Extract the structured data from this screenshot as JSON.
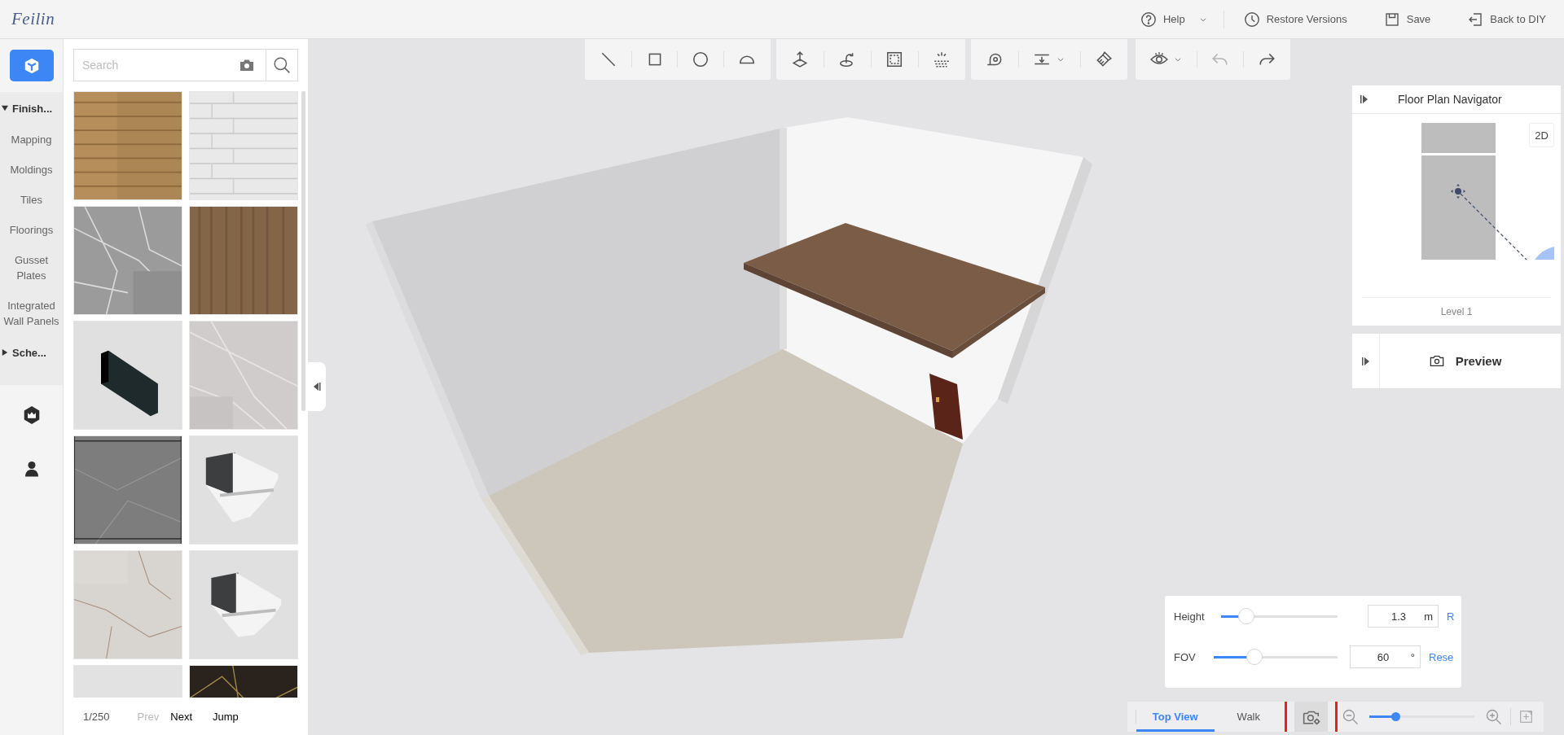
{
  "logo": "Feilin",
  "header_actions": [
    {
      "kind": "help",
      "label": "Help",
      "dropdown": true
    },
    {
      "kind": "history",
      "label": "Restore Versions",
      "dropdown": false
    },
    {
      "kind": "save",
      "label": "Save",
      "dropdown": false
    },
    {
      "kind": "exit",
      "label": "Back to DIY",
      "dropdown": false
    }
  ],
  "rail": {
    "top_button": {
      "kind": "cube",
      "selected": true
    },
    "tree": [
      {
        "label": "Finish...",
        "expanded": true,
        "children": [
          {
            "label": "Mapping"
          },
          {
            "label": "Moldings"
          },
          {
            "label": "Tiles"
          },
          {
            "label": "Floorings"
          },
          {
            "label": "Gusset Plates"
          },
          {
            "label": "Integrated Wall Panels"
          }
        ]
      },
      {
        "label": "Sche...",
        "expanded": false
      }
    ],
    "buttons": [
      {
        "kind": "crown",
        "selected": false
      },
      {
        "kind": "person",
        "selected": false
      }
    ]
  },
  "materials": {
    "search": {
      "placeholder": "Search"
    },
    "pagination": {
      "page": "1/250",
      "prev": {
        "label": "Prev",
        "disabled": true
      },
      "next": {
        "label": "Next",
        "disabled": false
      },
      "jump": "Jump"
    }
  },
  "toolbar": [
    {
      "tools": [
        {
          "kind": "line",
          "dropdown": false,
          "disabled": false
        },
        {
          "kind": "rect",
          "dropdown": false,
          "disabled": false
        },
        {
          "kind": "circle",
          "dropdown": false,
          "disabled": false
        },
        {
          "kind": "arc",
          "dropdown": false,
          "disabled": false
        }
      ]
    },
    {
      "tools": [
        {
          "kind": "extrude",
          "dropdown": false,
          "disabled": false
        },
        {
          "kind": "rotate",
          "dropdown": false,
          "disabled": false
        },
        {
          "kind": "frame",
          "dropdown": false,
          "disabled": false
        },
        {
          "kind": "light",
          "dropdown": false,
          "disabled": false
        }
      ]
    },
    {
      "tools": [
        {
          "kind": "measure",
          "dropdown": false,
          "disabled": false
        },
        {
          "kind": "align",
          "dropdown": true,
          "disabled": false
        },
        {
          "kind": "brush",
          "dropdown": false,
          "disabled": false
        }
      ]
    },
    {
      "tools": [
        {
          "kind": "eye",
          "dropdown": true,
          "disabled": false
        },
        {
          "kind": "undo",
          "dropdown": false,
          "disabled": true
        },
        {
          "kind": "redo",
          "dropdown": false,
          "disabled": false
        }
      ]
    }
  ],
  "navigator": {
    "title": "Floor Plan Navigator",
    "mode_button": "2D",
    "level": "Level 1"
  },
  "preview": {
    "label": "Preview"
  },
  "camera_settings": {
    "rows": [
      {
        "label": "Height",
        "level": 0.22,
        "value": "1.3",
        "unit": "m",
        "action": "R"
      },
      {
        "label": "FOV",
        "level": 0.33,
        "value": "60",
        "unit": "°",
        "action": "Rese"
      }
    ]
  },
  "view_bar": {
    "tabs": [
      {
        "label": "Top View",
        "selected": true
      },
      {
        "label": "Walk",
        "selected": false
      }
    ],
    "camera_button": {
      "highlighted": true
    },
    "zoom": {
      "level": 0.25
    }
  }
}
